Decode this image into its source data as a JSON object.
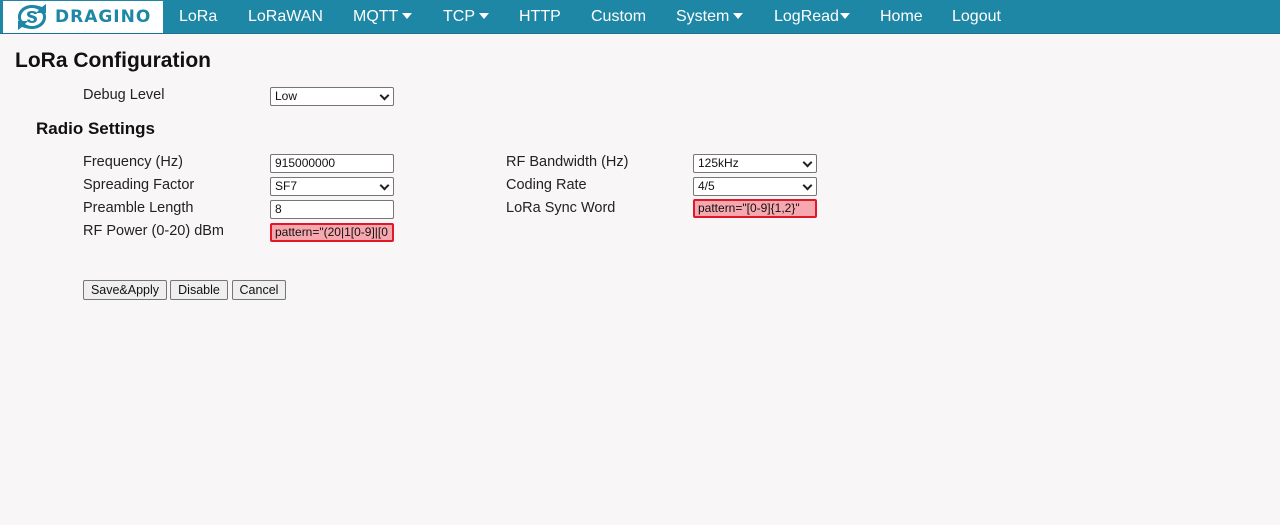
{
  "brand": {
    "name": "DRAGINO",
    "color": "#1e87a6"
  },
  "nav": {
    "items": [
      {
        "label": "LoRa",
        "dropdown": false
      },
      {
        "label": "LoRaWAN",
        "dropdown": false
      },
      {
        "label": "MQTT",
        "dropdown": true
      },
      {
        "label": "TCP",
        "dropdown": true
      },
      {
        "label": "HTTP",
        "dropdown": false
      },
      {
        "label": "Custom",
        "dropdown": false
      },
      {
        "label": "System",
        "dropdown": true
      },
      {
        "label": "LogRead",
        "dropdown": true
      },
      {
        "label": "Home",
        "dropdown": false
      },
      {
        "label": "Logout",
        "dropdown": false
      }
    ]
  },
  "page": {
    "title": "LoRa Configuration",
    "debug": {
      "label": "Debug Level",
      "value": "Low"
    },
    "radio": {
      "title": "Radio Settings",
      "frequency": {
        "label": "Frequency (Hz)",
        "value": "915000000"
      },
      "spreading_factor": {
        "label": "Spreading Factor",
        "value": "SF7"
      },
      "preamble": {
        "label": "Preamble Length",
        "value": "8"
      },
      "rf_power": {
        "label": "RF Power (0-20) dBm",
        "value": "pattern=\"(20|1[0-9]|[0"
      },
      "bandwidth": {
        "label": "RF Bandwidth (Hz)",
        "value": "125kHz"
      },
      "coding_rate": {
        "label": "Coding Rate",
        "value": "4/5"
      },
      "sync_word": {
        "label": "LoRa Sync Word",
        "value": "pattern=\"[0-9]{1,2}\""
      }
    },
    "buttons": {
      "save": "Save&Apply",
      "disable": "Disable",
      "cancel": "Cancel"
    }
  },
  "colors": {
    "nav_bg": "#1e87a6",
    "page_bg": "#f9f6f8",
    "invalid_bg": "#f7a7ae",
    "invalid_border": "#e0182a"
  }
}
